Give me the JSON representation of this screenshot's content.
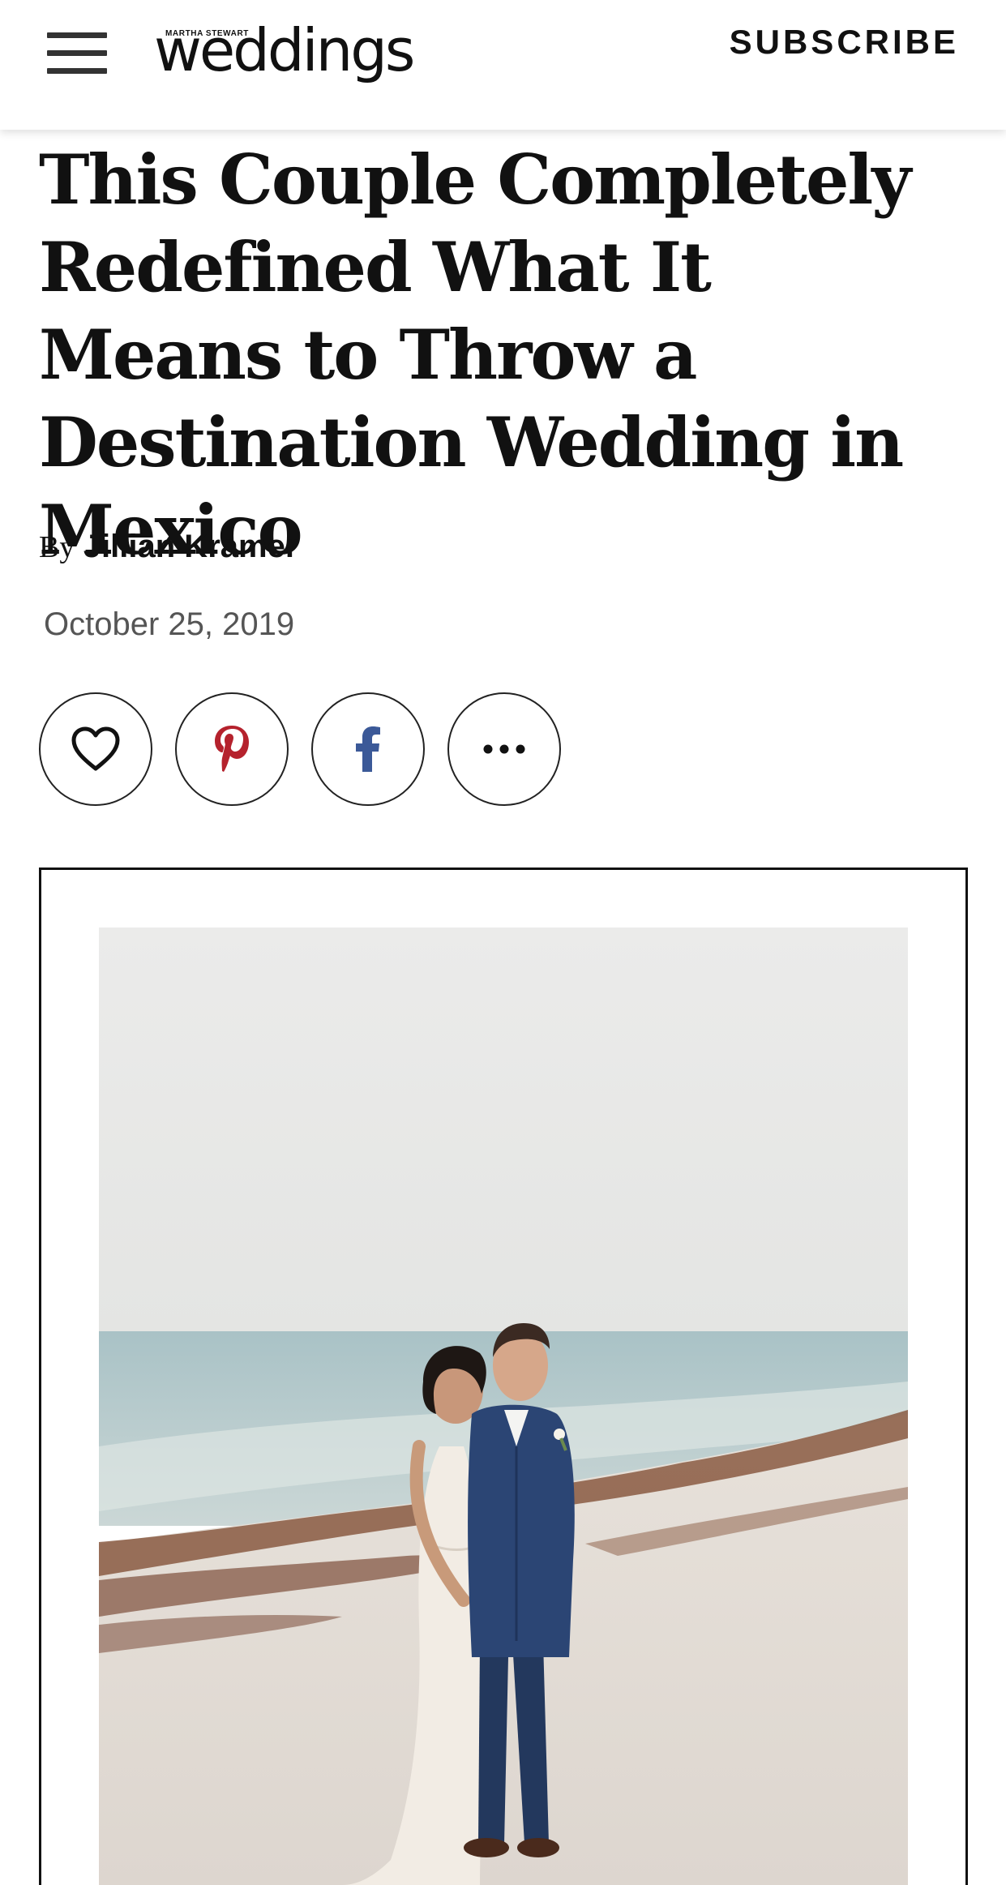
{
  "header": {
    "menu_icon": "hamburger-menu-icon",
    "logo_top": "MARTHA STEWART",
    "logo_main": "weddings",
    "subscribe_label": "SUBSCRIBE"
  },
  "article": {
    "title": "This Couple Completely Redefined What It Means to Throw a Destination Wedding in Mexico",
    "byline_prefix": "By",
    "author": "Jillian Kramer",
    "date": "October 25, 2019"
  },
  "share": {
    "buttons": [
      {
        "icon": "heart-icon",
        "color": "#111111"
      },
      {
        "icon": "pinterest-icon",
        "color": "#b5222d"
      },
      {
        "icon": "facebook-icon",
        "color": "#3b5998"
      },
      {
        "icon": "more-options-icon",
        "color": "#111111"
      }
    ]
  },
  "hero_image": {
    "subject": "bride-and-groom-on-beach"
  },
  "colors": {
    "text": "#111111",
    "date_text": "#555555",
    "background": "#ffffff"
  }
}
